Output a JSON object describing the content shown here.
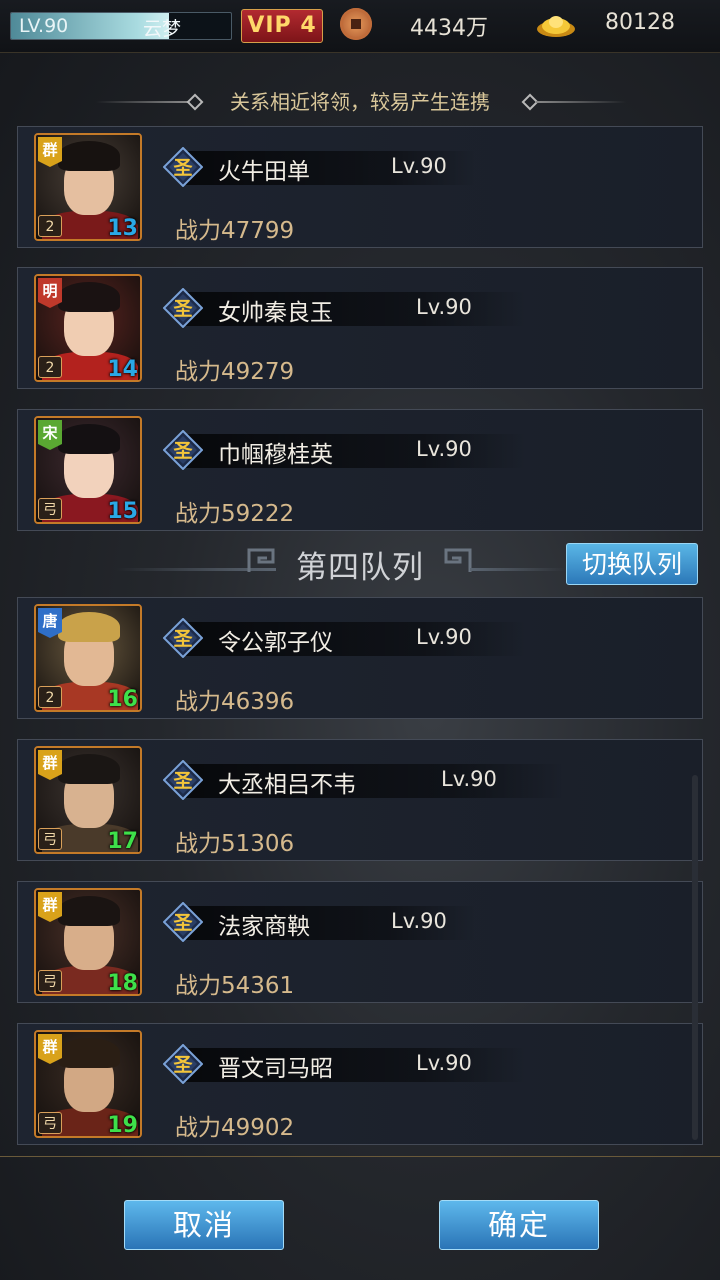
{
  "topbar": {
    "level": "LV.90",
    "player_name": "云梦",
    "exp_progress": 0.72,
    "vip": "VIP 4",
    "copper": "4434万",
    "gold": "80128"
  },
  "note": "关系相近将领，较易产生连携",
  "section_title": "第四队列",
  "switch_label": "切换队列",
  "rank_glyph": "圣",
  "generals": [
    {
      "name": "火牛田单",
      "level": "Lv.90",
      "power": "战力47799",
      "faction": "群",
      "faction_color": "#d9a21a",
      "role": "2",
      "num": "13",
      "num_color": "#2aa8e6",
      "skin": "#e5bfa0",
      "hair": "#171210",
      "body": "#7a1a1a",
      "bg": "#4a4038"
    },
    {
      "name": "女帅秦良玉",
      "level": "Lv.90",
      "power": "战力49279",
      "faction": "明",
      "faction_color": "#c0392b",
      "role": "2",
      "num": "14",
      "num_color": "#2aa8e6",
      "skin": "#f0cdb2",
      "hair": "#1a1212",
      "body": "#b3221e",
      "bg": "#5a2420"
    },
    {
      "name": "巾帼穆桂英",
      "level": "Lv.90",
      "power": "战力59222",
      "faction": "宋",
      "faction_color": "#5aa832",
      "role": "弓",
      "num": "15",
      "num_color": "#2aa8e6",
      "skin": "#f2d2bc",
      "hair": "#141012",
      "body": "#8a1820",
      "bg": "#3e2a30"
    },
    {
      "name": "令公郭子仪",
      "level": "Lv.90",
      "power": "战力46396",
      "faction": "唐",
      "faction_color": "#2f6fc8",
      "role": "2",
      "num": "16",
      "num_color": "#3ee04a",
      "skin": "#e2b894",
      "hair": "#c9a24a",
      "body": "#a83824",
      "bg": "#6a5a40"
    },
    {
      "name": "大丞相吕不韦",
      "level": "Lv.90",
      "power": "战力51306",
      "faction": "群",
      "faction_color": "#d9a21a",
      "role": "弓",
      "num": "17",
      "num_color": "#3ee04a",
      "skin": "#d8b290",
      "hair": "#1a1614",
      "body": "#4a3a2a",
      "bg": "#3c3430"
    },
    {
      "name": "法家商鞅",
      "level": "Lv.90",
      "power": "战力54361",
      "faction": "群",
      "faction_color": "#d9a21a",
      "role": "弓",
      "num": "18",
      "num_color": "#3ee04a",
      "skin": "#d8ae8a",
      "hair": "#1a1412",
      "body": "#7a2a20",
      "bg": "#4a3028"
    },
    {
      "name": "晋文司马昭",
      "level": "Lv.90",
      "power": "战力49902",
      "faction": "群",
      "faction_color": "#d9a21a",
      "role": "弓",
      "num": "19",
      "num_color": "#3ee04a",
      "skin": "#d2a884",
      "hair": "#2a1e14",
      "body": "#6a2418",
      "bg": "#3a2c24"
    }
  ],
  "cancel_label": "取消",
  "confirm_label": "确定"
}
